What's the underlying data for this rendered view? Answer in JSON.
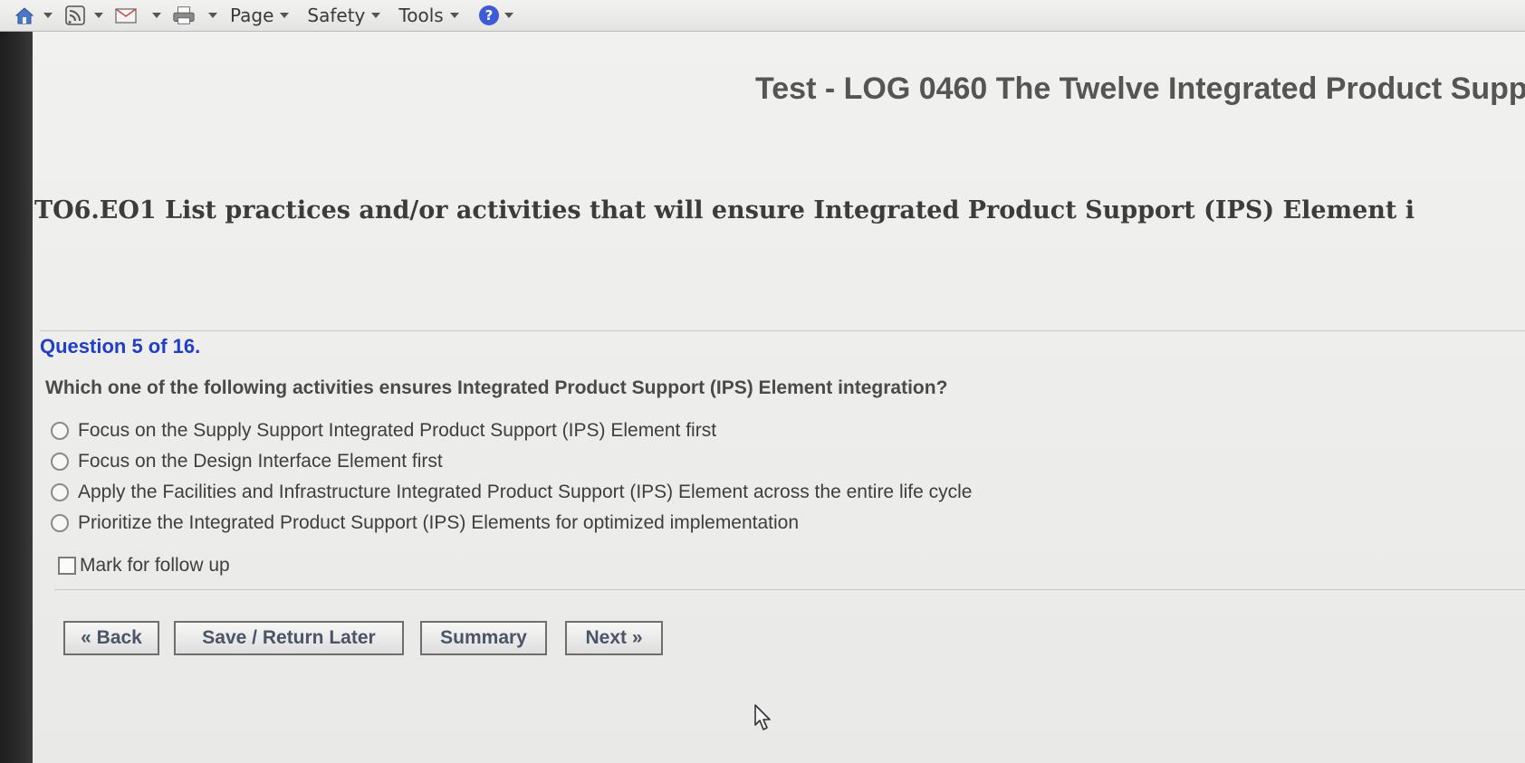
{
  "toolbar": {
    "page_label": "Page",
    "safety_label": "Safety",
    "tools_label": "Tools"
  },
  "header": {
    "test_title": "Test - LOG 0460 The Twelve Integrated Product Supp"
  },
  "objective": {
    "text": "TO6.EO1 List practices and/or activities that will ensure Integrated Product Support (IPS) Element i"
  },
  "question": {
    "number_label": "Question 5 of 16.",
    "text": "Which one of the following activities ensures Integrated Product Support (IPS) Element integration?",
    "options": [
      "Focus on the Supply Support Integrated Product Support (IPS) Element first",
      "Focus on the Design Interface Element first",
      "Apply the Facilities and Infrastructure Integrated Product Support (IPS) Element across the entire life cycle",
      "Prioritize the Integrated Product Support (IPS) Elements for optimized implementation"
    ],
    "follow_up_label": "Mark for follow up"
  },
  "buttons": {
    "back": "« Back",
    "save": "Save / Return Later",
    "summary": "Summary",
    "next": "Next »"
  },
  "colors": {
    "question_number": "#1f3ecc",
    "help_icon": "#3d5bd9"
  }
}
